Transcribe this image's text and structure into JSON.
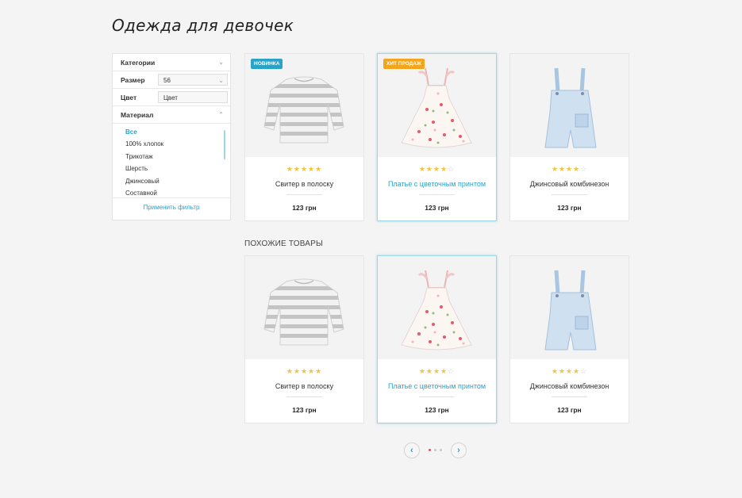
{
  "page_title": "Одежда для девочек",
  "filters": {
    "categories_label": "Категории",
    "size_label": "Размер",
    "size_value": "56",
    "color_label": "Цвет",
    "color_placeholder": "Цвет",
    "material_label": "Материал",
    "materials": [
      "Все",
      "100% хлопок",
      "Трикотаж",
      "Шерсть",
      "Джинсовый",
      "Составной"
    ],
    "apply_label": "Применить фильтр"
  },
  "products": [
    {
      "name": "Свитер в полоску",
      "price": "123 грн",
      "rating": 5,
      "badge": "НОВИНКА",
      "badge_color": "#2aa3c6"
    },
    {
      "name": "Платье с цветочным принтом",
      "price": "123 грн",
      "rating": 4,
      "badge": "ХИТ ПРОДАЖ",
      "badge_color": "#f2a51d"
    },
    {
      "name": "Джинсовый комбинезон",
      "price": "123 грн",
      "rating": 4,
      "badge": ""
    }
  ],
  "similar_title": "ПОХОЖИЕ ТОВАРЫ",
  "similar_products": [
    {
      "name": "Свитер в полоску",
      "price": "123 грн",
      "rating": 5
    },
    {
      "name": "Платье с цветочным принтом",
      "price": "123 грн",
      "rating": 4
    },
    {
      "name": "Джинсовый комбинезон",
      "price": "123 грн",
      "rating": 4
    }
  ],
  "pager": {
    "prev_icon": "chevron-left-icon",
    "next_icon": "chevron-right-icon",
    "pages": 3,
    "current": 1
  },
  "colors": {
    "accent": "#2aa3c6",
    "star": "#f3c33e",
    "hit_badge": "#f2a51d",
    "dot_active": "#e0526b"
  }
}
